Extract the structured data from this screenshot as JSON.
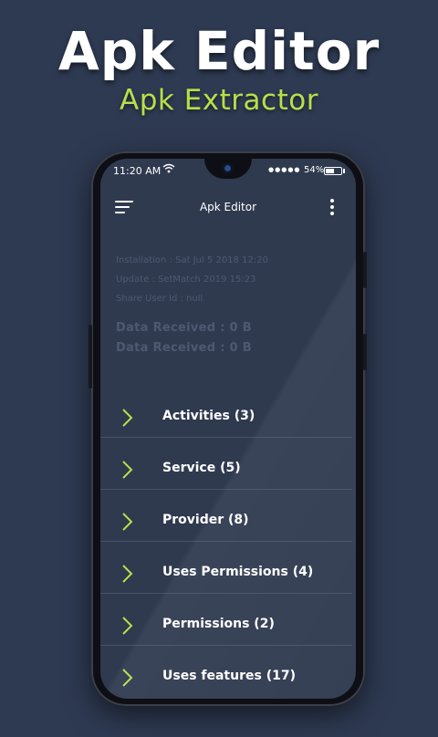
{
  "promo": {
    "title": "Apk Editor",
    "subtitle": "Apk Extractor",
    "title_color": "#ffffff",
    "subtitle_color": "#b6e04a",
    "background": "#2e3a52"
  },
  "status_bar": {
    "time": "11:20 AM",
    "signal": "●●●●●",
    "battery_percent": "54%",
    "battery_level": 0.54
  },
  "app_bar": {
    "title": "Apk Editor",
    "menu_icon": "hamburger-menu-icon",
    "more_icon": "more-vertical-icon"
  },
  "info": {
    "installation": "Installation : Sat Jul 5 2018 12:20",
    "update": "Update : SetMatch 2019 15:23",
    "share_user_id": "Share User Id : null",
    "data_received_1": "Data Received : 0 B",
    "data_received_2": "Data Received : 0 B"
  },
  "list": {
    "chevron_color": "#b6e04a",
    "items": [
      {
        "label": "Activities (3)"
      },
      {
        "label": "Service (5)"
      },
      {
        "label": "Provider (8)"
      },
      {
        "label": "Uses Permissions (4)"
      },
      {
        "label": "Permissions (2)"
      },
      {
        "label": "Uses features (17)"
      }
    ]
  }
}
